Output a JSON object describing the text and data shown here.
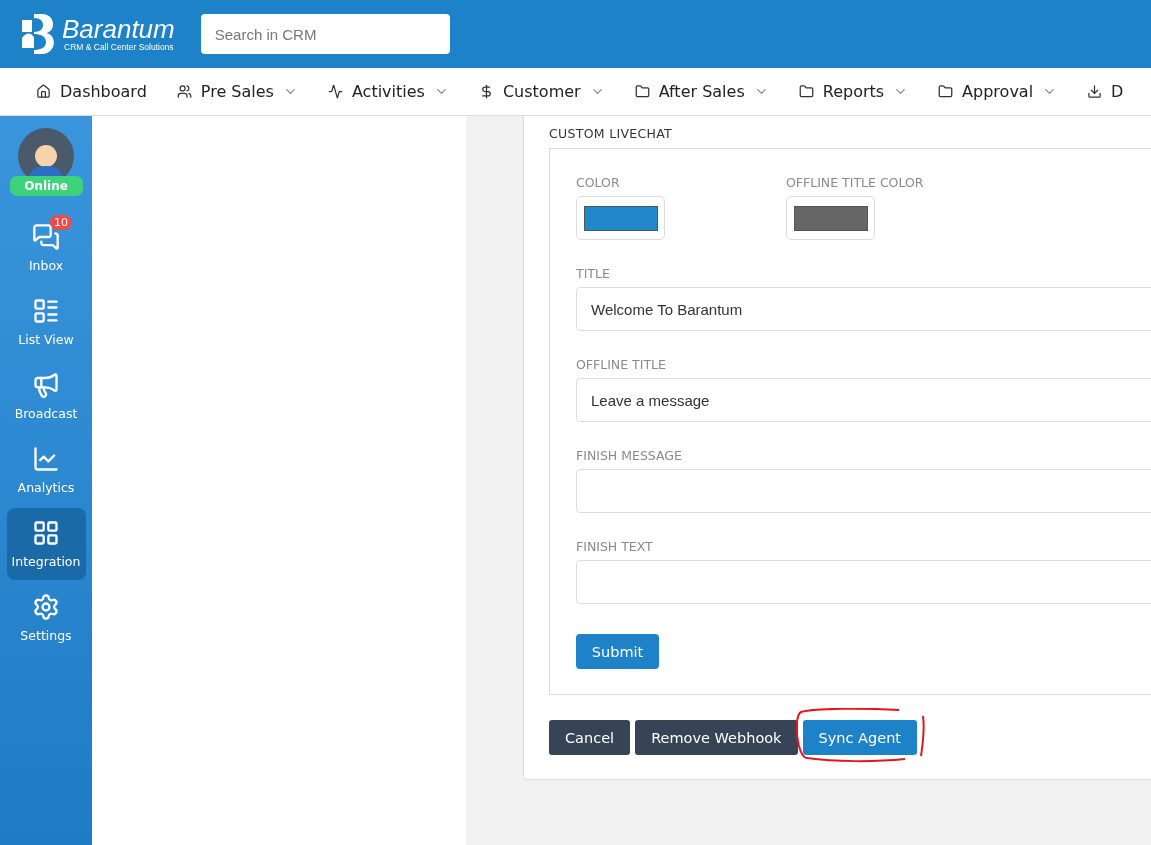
{
  "brand": {
    "name": "Barantum",
    "tagline": "CRM & Call Center Solutions"
  },
  "search": {
    "placeholder": "Search in CRM"
  },
  "nav": [
    {
      "kind": "home",
      "label": "Dashboard",
      "caret": false
    },
    {
      "kind": "users",
      "label": "Pre Sales",
      "caret": true
    },
    {
      "kind": "activity",
      "label": "Activities",
      "caret": true
    },
    {
      "kind": "dollar",
      "label": "Customer",
      "caret": true
    },
    {
      "kind": "folder",
      "label": "After Sales",
      "caret": true
    },
    {
      "kind": "folder",
      "label": "Reports",
      "caret": true
    },
    {
      "kind": "folder",
      "label": "Approval",
      "caret": true
    },
    {
      "kind": "download",
      "label": "D",
      "caret": false
    }
  ],
  "user": {
    "status": "Online"
  },
  "sidebar": [
    {
      "kind": "inbox",
      "label": "Inbox",
      "badge": "10",
      "selected": false
    },
    {
      "kind": "list",
      "label": "List View",
      "selected": false
    },
    {
      "kind": "broadcast",
      "label": "Broadcast",
      "selected": false
    },
    {
      "kind": "analytics",
      "label": "Analytics",
      "selected": false
    },
    {
      "kind": "integration",
      "label": "Integration",
      "selected": true
    },
    {
      "kind": "settings",
      "label": "Settings",
      "selected": false
    }
  ],
  "section": {
    "title": "CUSTOM LIVECHAT",
    "color_fields": [
      {
        "label": "COLOR",
        "color": "#2288cc"
      },
      {
        "label": "OFFLINE TITLE COLOR",
        "color": "#666666"
      }
    ],
    "text_fields": [
      {
        "label": "TITLE",
        "value": "Welcome To Barantum"
      },
      {
        "label": "OFFLINE TITLE",
        "value": "Leave a message"
      },
      {
        "label": "FINISH MESSAGE"
      },
      {
        "label": "FINISH TEXT"
      }
    ],
    "submit": "Submit"
  },
  "actions": [
    {
      "kind": "dark",
      "label": "Cancel",
      "annotated": false
    },
    {
      "kind": "dark",
      "label": "Remove Webhook",
      "annotated": false
    },
    {
      "kind": "primary",
      "label": "Sync Agent",
      "annotated": true
    }
  ]
}
